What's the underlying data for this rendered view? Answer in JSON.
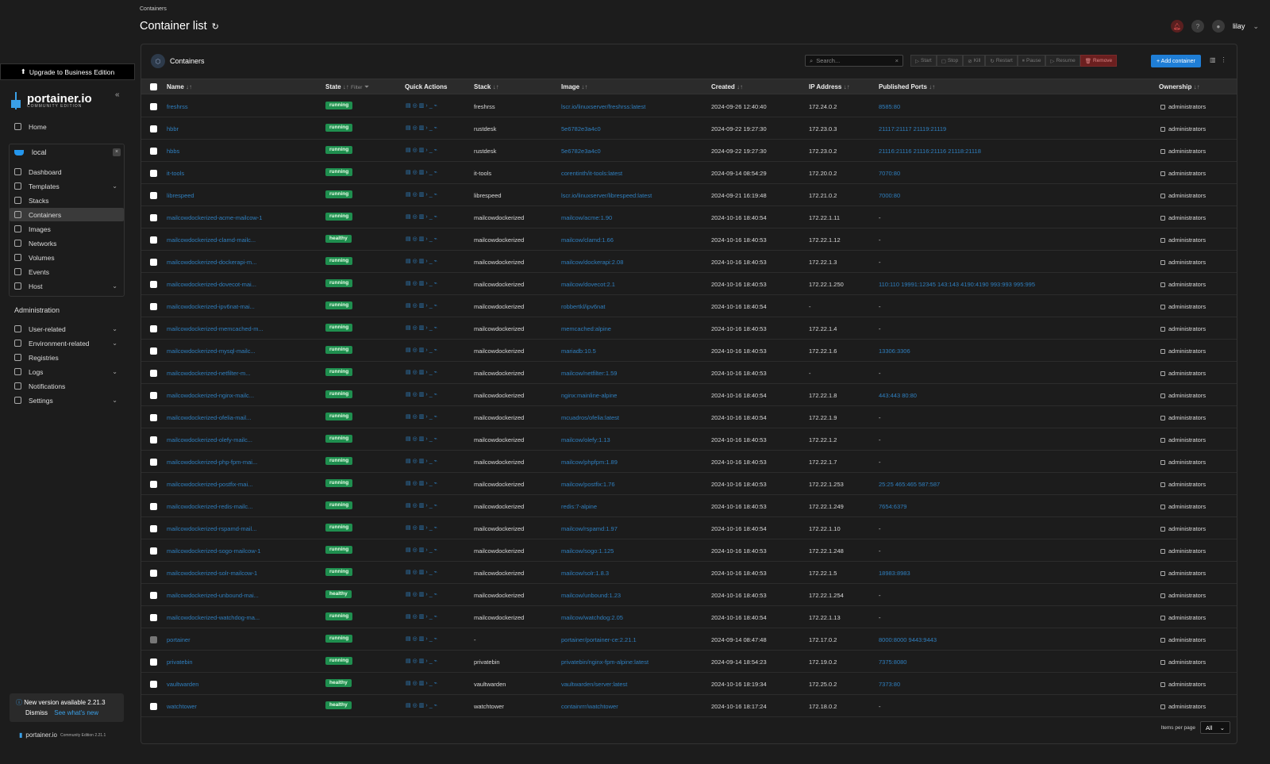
{
  "sidebar": {
    "upgrade_label": "Upgrade to Business Edition",
    "brand": "portainer.io",
    "edition": "COMMUNITY EDITION",
    "home_label": "Home",
    "env_name": "local",
    "env_items": [
      {
        "label": "Dashboard",
        "chevron": ""
      },
      {
        "label": "Templates",
        "chevron": "⌄"
      },
      {
        "label": "Stacks",
        "chevron": ""
      },
      {
        "label": "Containers",
        "chevron": ""
      },
      {
        "label": "Images",
        "chevron": ""
      },
      {
        "label": "Networks",
        "chevron": ""
      },
      {
        "label": "Volumes",
        "chevron": ""
      },
      {
        "label": "Events",
        "chevron": ""
      },
      {
        "label": "Host",
        "chevron": "⌄"
      }
    ],
    "admin_title": "Administration",
    "admin_items": [
      {
        "label": "User-related",
        "chevron": "⌄"
      },
      {
        "label": "Environment-related",
        "chevron": "⌄"
      },
      {
        "label": "Registries",
        "chevron": ""
      },
      {
        "label": "Logs",
        "chevron": "⌄"
      },
      {
        "label": "Notifications",
        "chevron": ""
      },
      {
        "label": "Settings",
        "chevron": "⌄"
      }
    ],
    "new_version": "New version available 2.21.3",
    "dismiss": "Dismiss",
    "see_whats_new": "See what's new",
    "footer_brand": "portainer.io",
    "footer_edition": "Community Edition 2.21.1"
  },
  "header": {
    "breadcrumb": "Containers",
    "title": "Container list",
    "user": "lilay"
  },
  "panel": {
    "title": "Containers",
    "search_placeholder": "Search...",
    "actions": [
      "Start",
      "Stop",
      "Kill",
      "Restart",
      "Pause",
      "Resume",
      "Remove"
    ],
    "add_label": "+ Add container",
    "columns": {
      "name": "Name",
      "state": "State",
      "filter": "Filter",
      "quick": "Quick Actions",
      "stack": "Stack",
      "image": "Image",
      "created": "Created",
      "ip": "IP Address",
      "ports": "Published Ports",
      "ownership": "Ownership"
    },
    "items_per_page_label": "Items per page",
    "items_per_page_value": "All"
  },
  "accent": "#1f7ed6",
  "status_color": "#1f8f4f",
  "rows": [
    {
      "name": "freshrss",
      "state": "running",
      "stack": "freshrss",
      "image": "lscr.io/linuxserver/freshrss:latest",
      "created": "2024-09-26 12:40:40",
      "ip": "172.24.0.2",
      "ports": "8585:80",
      "owner": "administrators"
    },
    {
      "name": "hbbr",
      "state": "running",
      "stack": "rustdesk",
      "image": "5e6782e3a4c0",
      "created": "2024-09-22 19:27:30",
      "ip": "172.23.0.3",
      "ports": "21117:21117  21119:21119",
      "owner": "administrators"
    },
    {
      "name": "hbbs",
      "state": "running",
      "stack": "rustdesk",
      "image": "5e6782e3a4c0",
      "created": "2024-09-22 19:27:30",
      "ip": "172.23.0.2",
      "ports": "21116:21116  21116:21116  21118:21118",
      "owner": "administrators"
    },
    {
      "name": "it-tools",
      "state": "running",
      "stack": "it-tools",
      "image": "corentinth/it-tools:latest",
      "created": "2024-09-14 08:54:29",
      "ip": "172.20.0.2",
      "ports": "7070:80",
      "owner": "administrators"
    },
    {
      "name": "librespeed",
      "state": "running",
      "stack": "librespeed",
      "image": "lscr.io/linuxserver/librespeed:latest",
      "created": "2024-09-21 16:19:48",
      "ip": "172.21.0.2",
      "ports": "7000:80",
      "owner": "administrators"
    },
    {
      "name": "mailcowdockerized-acme-mailcow-1",
      "state": "running",
      "stack": "mailcowdockerized",
      "image": "mailcow/acme:1.90",
      "created": "2024-10-16 18:40:54",
      "ip": "172.22.1.11",
      "ports": "-",
      "owner": "administrators"
    },
    {
      "name": "mailcowdockerized-clamd-mailc...",
      "state": "healthy",
      "stack": "mailcowdockerized",
      "image": "mailcow/clamd:1.66",
      "created": "2024-10-16 18:40:53",
      "ip": "172.22.1.12",
      "ports": "-",
      "owner": "administrators"
    },
    {
      "name": "mailcowdockerized-dockerapi-m...",
      "state": "running",
      "stack": "mailcowdockerized",
      "image": "mailcow/dockerapi:2.08",
      "created": "2024-10-16 18:40:53",
      "ip": "172.22.1.3",
      "ports": "-",
      "owner": "administrators"
    },
    {
      "name": "mailcowdockerized-dovecot-mai...",
      "state": "running",
      "stack": "mailcowdockerized",
      "image": "mailcow/dovecot:2.1",
      "created": "2024-10-16 18:40:53",
      "ip": "172.22.1.250",
      "ports": "110:110  19991:12345  143:143  4190:4190  993:993  995:995",
      "owner": "administrators"
    },
    {
      "name": "mailcowdockerized-ipv6nat-mai...",
      "state": "running",
      "stack": "mailcowdockerized",
      "image": "robbertkl/ipv6nat",
      "created": "2024-10-16 18:40:54",
      "ip": "-",
      "ports": "-",
      "owner": "administrators"
    },
    {
      "name": "mailcowdockerized-memcached-m...",
      "state": "running",
      "stack": "mailcowdockerized",
      "image": "memcached:alpine",
      "created": "2024-10-16 18:40:53",
      "ip": "172.22.1.4",
      "ports": "-",
      "owner": "administrators"
    },
    {
      "name": "mailcowdockerized-mysql-mailc...",
      "state": "running",
      "stack": "mailcowdockerized",
      "image": "mariadb:10.5",
      "created": "2024-10-16 18:40:53",
      "ip": "172.22.1.6",
      "ports": "13306:3306",
      "owner": "administrators"
    },
    {
      "name": "mailcowdockerized-netfilter-m...",
      "state": "running",
      "stack": "mailcowdockerized",
      "image": "mailcow/netfilter:1.59",
      "created": "2024-10-16 18:40:53",
      "ip": "-",
      "ports": "-",
      "owner": "administrators"
    },
    {
      "name": "mailcowdockerized-nginx-mailc...",
      "state": "running",
      "stack": "mailcowdockerized",
      "image": "nginx:mainline-alpine",
      "created": "2024-10-16 18:40:54",
      "ip": "172.22.1.8",
      "ports": "443:443  80:80",
      "owner": "administrators"
    },
    {
      "name": "mailcowdockerized-ofelia-mail...",
      "state": "running",
      "stack": "mailcowdockerized",
      "image": "mcuadros/ofelia:latest",
      "created": "2024-10-16 18:40:54",
      "ip": "172.22.1.9",
      "ports": "-",
      "owner": "administrators"
    },
    {
      "name": "mailcowdockerized-olefy-mailc...",
      "state": "running",
      "stack": "mailcowdockerized",
      "image": "mailcow/olefy:1.13",
      "created": "2024-10-16 18:40:53",
      "ip": "172.22.1.2",
      "ports": "-",
      "owner": "administrators"
    },
    {
      "name": "mailcowdockerized-php-fpm-mai...",
      "state": "running",
      "stack": "mailcowdockerized",
      "image": "mailcow/phpfpm:1.89",
      "created": "2024-10-16 18:40:53",
      "ip": "172.22.1.7",
      "ports": "-",
      "owner": "administrators"
    },
    {
      "name": "mailcowdockerized-postfix-mai...",
      "state": "running",
      "stack": "mailcowdockerized",
      "image": "mailcow/postfix:1.76",
      "created": "2024-10-16 18:40:53",
      "ip": "172.22.1.253",
      "ports": "25:25  465:465  587:587",
      "owner": "administrators"
    },
    {
      "name": "mailcowdockerized-redis-mailc...",
      "state": "running",
      "stack": "mailcowdockerized",
      "image": "redis:7-alpine",
      "created": "2024-10-16 18:40:53",
      "ip": "172.22.1.249",
      "ports": "7654:6379",
      "owner": "administrators"
    },
    {
      "name": "mailcowdockerized-rspamd-mail...",
      "state": "running",
      "stack": "mailcowdockerized",
      "image": "mailcow/rspamd:1.97",
      "created": "2024-10-16 18:40:54",
      "ip": "172.22.1.10",
      "ports": "-",
      "owner": "administrators"
    },
    {
      "name": "mailcowdockerized-sogo-mailcow-1",
      "state": "running",
      "stack": "mailcowdockerized",
      "image": "mailcow/sogo:1.125",
      "created": "2024-10-16 18:40:53",
      "ip": "172.22.1.248",
      "ports": "-",
      "owner": "administrators"
    },
    {
      "name": "mailcowdockerized-solr-mailcow-1",
      "state": "running",
      "stack": "mailcowdockerized",
      "image": "mailcow/solr:1.8.3",
      "created": "2024-10-16 18:40:53",
      "ip": "172.22.1.5",
      "ports": "18983:8983",
      "owner": "administrators"
    },
    {
      "name": "mailcowdockerized-unbound-mai...",
      "state": "healthy",
      "stack": "mailcowdockerized",
      "image": "mailcow/unbound:1.23",
      "created": "2024-10-16 18:40:53",
      "ip": "172.22.1.254",
      "ports": "-",
      "owner": "administrators"
    },
    {
      "name": "mailcowdockerized-watchdog-ma...",
      "state": "running",
      "stack": "mailcowdockerized",
      "image": "mailcow/watchdog:2.05",
      "created": "2024-10-16 18:40:54",
      "ip": "172.22.1.13",
      "ports": "-",
      "owner": "administrators"
    },
    {
      "name": "portainer",
      "state": "running",
      "stack": "-",
      "image": "portainer/portainer-ce:2.21.1",
      "created": "2024-09-14 08:47:48",
      "ip": "172.17.0.2",
      "ports": "8000:8000  9443:9443",
      "owner": "administrators"
    },
    {
      "name": "privatebin",
      "state": "running",
      "stack": "privatebin",
      "image": "privatebin/nginx-fpm-alpine:latest",
      "created": "2024-09-14 18:54:23",
      "ip": "172.19.0.2",
      "ports": "7375:8080",
      "owner": "administrators"
    },
    {
      "name": "vaultwarden",
      "state": "healthy",
      "stack": "vaultwarden",
      "image": "vaultwarden/server:latest",
      "created": "2024-10-16 18:19:34",
      "ip": "172.25.0.2",
      "ports": "7373:80",
      "owner": "administrators"
    },
    {
      "name": "watchtower",
      "state": "healthy",
      "stack": "watchtower",
      "image": "containrrr/watchtower",
      "created": "2024-10-16 18:17:24",
      "ip": "172.18.0.2",
      "ports": "-",
      "owner": "administrators"
    }
  ]
}
